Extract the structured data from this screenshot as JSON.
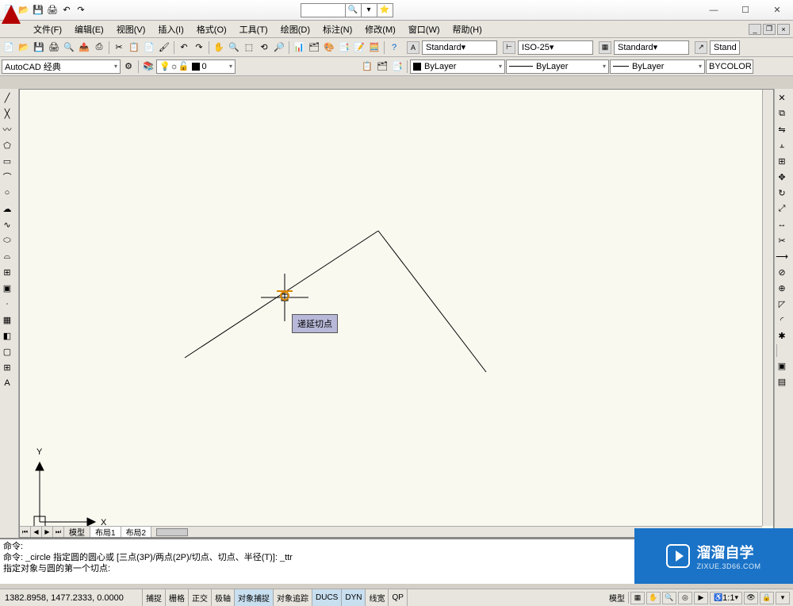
{
  "menu": {
    "file": "文件(F)",
    "edit": "编辑(E)",
    "view": "视图(V)",
    "insert": "插入(I)",
    "format": "格式(O)",
    "tools": "工具(T)",
    "draw": "绘图(D)",
    "dimension": "标注(N)",
    "modify": "修改(M)",
    "window": "窗口(W)",
    "help": "帮助(H)"
  },
  "workspace": "AutoCAD 经典",
  "layer_combo": "0",
  "bylayer": "ByLayer",
  "bycolor": "BYCOLOR",
  "styles": {
    "text": "Standard",
    "dim": "ISO-25",
    "table": "Standard",
    "ml": "Stand"
  },
  "tabs": {
    "model": "模型",
    "layout1": "布局1",
    "layout2": "布局2"
  },
  "cmd": {
    "l1": "命令:",
    "l2": "命令: _circle 指定圆的圆心或 [三点(3P)/两点(2P)/切点、切点、半径(T)]: _ttr",
    "l3": "指定对象与圆的第一个切点:"
  },
  "osnap_tip": "递延切点",
  "coords": "1382.8958, 1477.2333, 0.0000",
  "toggles": {
    "snap": "捕捉",
    "grid": "栅格",
    "ortho": "正交",
    "polar": "极轴",
    "osnap": "对象捕捉",
    "otrack": "对象追踪",
    "ducs": "DUCS",
    "dyn": "DYN",
    "lwt": "线宽",
    "qp": "QP"
  },
  "modelbtn": "模型",
  "scale": "1:1",
  "watermark": {
    "title": "溜溜自学",
    "url": "ZIXUE.3D66.COM"
  }
}
